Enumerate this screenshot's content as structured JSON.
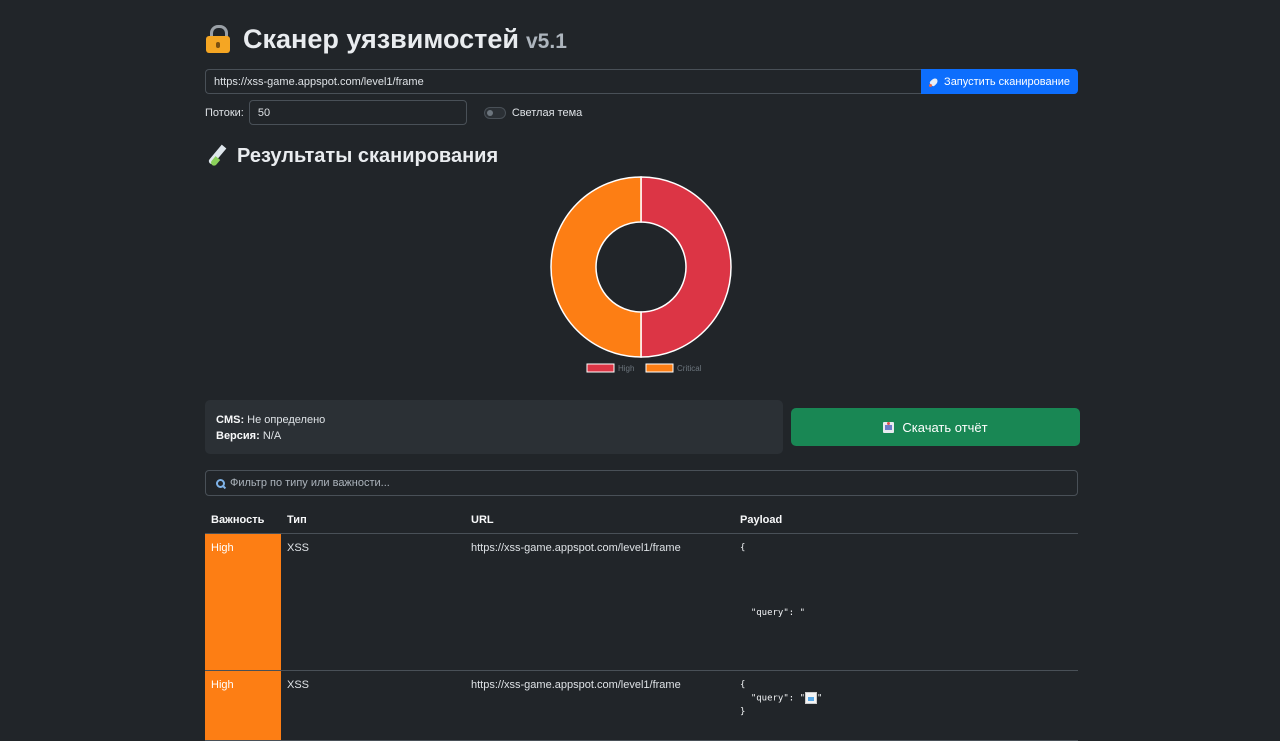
{
  "header": {
    "title": "Сканер уязвимостей",
    "version": "v5.1"
  },
  "scan": {
    "url_value": "https://xss-game.appspot.com/level1/frame",
    "scan_button": "Запустить сканирование"
  },
  "settings": {
    "threads_label": "Потоки:",
    "threads_value": "50",
    "theme_label": "Светлая тема",
    "theme_enabled": false
  },
  "results": {
    "title": "Результаты сканирования"
  },
  "chart_data": {
    "type": "pie",
    "variant": "doughnut",
    "categories": [
      "High",
      "Critical"
    ],
    "values": [
      1,
      1
    ],
    "colors": [
      "#dc3545",
      "#fd7e14"
    ],
    "legend_position": "bottom"
  },
  "info": {
    "cms_label": "CMS:",
    "cms_value": "Не определено",
    "version_label": "Версия:",
    "version_value": "N/A"
  },
  "download_button": "Скачать отчёт",
  "filter": {
    "placeholder": "Фильтр по типу или важности..."
  },
  "table": {
    "headers": [
      "Важность",
      "Тип",
      "URL",
      "Payload"
    ],
    "rows": [
      {
        "severity": "High",
        "type": "XSS",
        "url": "https://xss-game.appspot.com/level1/frame",
        "payload_lines": [
          "{",
          "",
          "",
          "",
          "",
          "  \"query\": \""
        ]
      },
      {
        "severity": "High",
        "type": "XSS",
        "url": "https://xss-game.appspot.com/level1/frame",
        "payload_lines": [
          "{",
          "  \"query\": \"",
          "}"
        ]
      }
    ]
  },
  "colors": {
    "background": "#212529",
    "primary": "#0d6efd",
    "success": "#198754",
    "high": "#fd7e14",
    "critical": "#dc3545"
  }
}
